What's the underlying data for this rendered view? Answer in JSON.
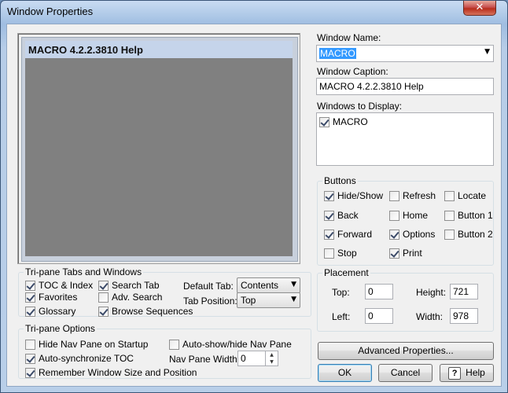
{
  "window": {
    "title": "Window Properties",
    "close_glyph": "✕"
  },
  "preview": {
    "caption": "MACRO 4.2.2.3810 Help"
  },
  "window_name": {
    "label": "Window Name:",
    "value": "MACRO"
  },
  "window_caption": {
    "label": "Window Caption:",
    "value": "MACRO 4.2.2.3810 Help"
  },
  "windows_to_display": {
    "label": "Windows to Display:",
    "items": [
      {
        "label": "MACRO",
        "checked": true
      }
    ]
  },
  "buttons_group": {
    "title": "Buttons",
    "items": [
      {
        "label": "Hide/Show",
        "checked": true
      },
      {
        "label": "Refresh",
        "checked": false
      },
      {
        "label": "Locate",
        "checked": false
      },
      {
        "label": "Back",
        "checked": true
      },
      {
        "label": "Home",
        "checked": false
      },
      {
        "label": "Button 1",
        "checked": false
      },
      {
        "label": "Forward",
        "checked": true
      },
      {
        "label": "Options",
        "checked": true
      },
      {
        "label": "Button 2",
        "checked": false
      },
      {
        "label": "Stop",
        "checked": false
      },
      {
        "label": "Print",
        "checked": true
      }
    ]
  },
  "tripane_tabs": {
    "title": "Tri-pane Tabs and Windows",
    "toc_index": {
      "label": "TOC & Index",
      "checked": true
    },
    "favorites": {
      "label": "Favorites",
      "checked": true
    },
    "glossary": {
      "label": "Glossary",
      "checked": true
    },
    "search_tab": {
      "label": "Search Tab",
      "checked": true
    },
    "adv_search": {
      "label": "Adv. Search",
      "checked": false
    },
    "browse_sequences": {
      "label": "Browse Sequences",
      "checked": true
    },
    "default_tab": {
      "label": "Default Tab:",
      "value": "Contents"
    },
    "tab_position": {
      "label": "Tab Position:",
      "value": "Top"
    }
  },
  "placement": {
    "title": "Placement",
    "top": {
      "label": "Top:",
      "value": "0"
    },
    "left": {
      "label": "Left:",
      "value": "0"
    },
    "height": {
      "label": "Height:",
      "value": "721"
    },
    "width": {
      "label": "Width:",
      "value": "978"
    }
  },
  "tripane_options": {
    "title": "Tri-pane Options",
    "hide_nav": {
      "label": "Hide Nav Pane on Startup",
      "checked": false
    },
    "auto_sync": {
      "label": "Auto-synchronize TOC",
      "checked": true
    },
    "remember_size": {
      "label": "Remember Window Size and Position",
      "checked": true
    },
    "auto_show": {
      "label": "Auto-show/hide Nav Pane",
      "checked": false
    },
    "nav_width": {
      "label": "Nav Pane Width:",
      "value": "0"
    }
  },
  "actions": {
    "advanced": "Advanced Properties...",
    "ok": "OK",
    "cancel": "Cancel",
    "help": "Help",
    "help_glyph": "?"
  },
  "icons": {
    "dropdown": "▼",
    "spin_up": "▲",
    "spin_down": "▼"
  }
}
